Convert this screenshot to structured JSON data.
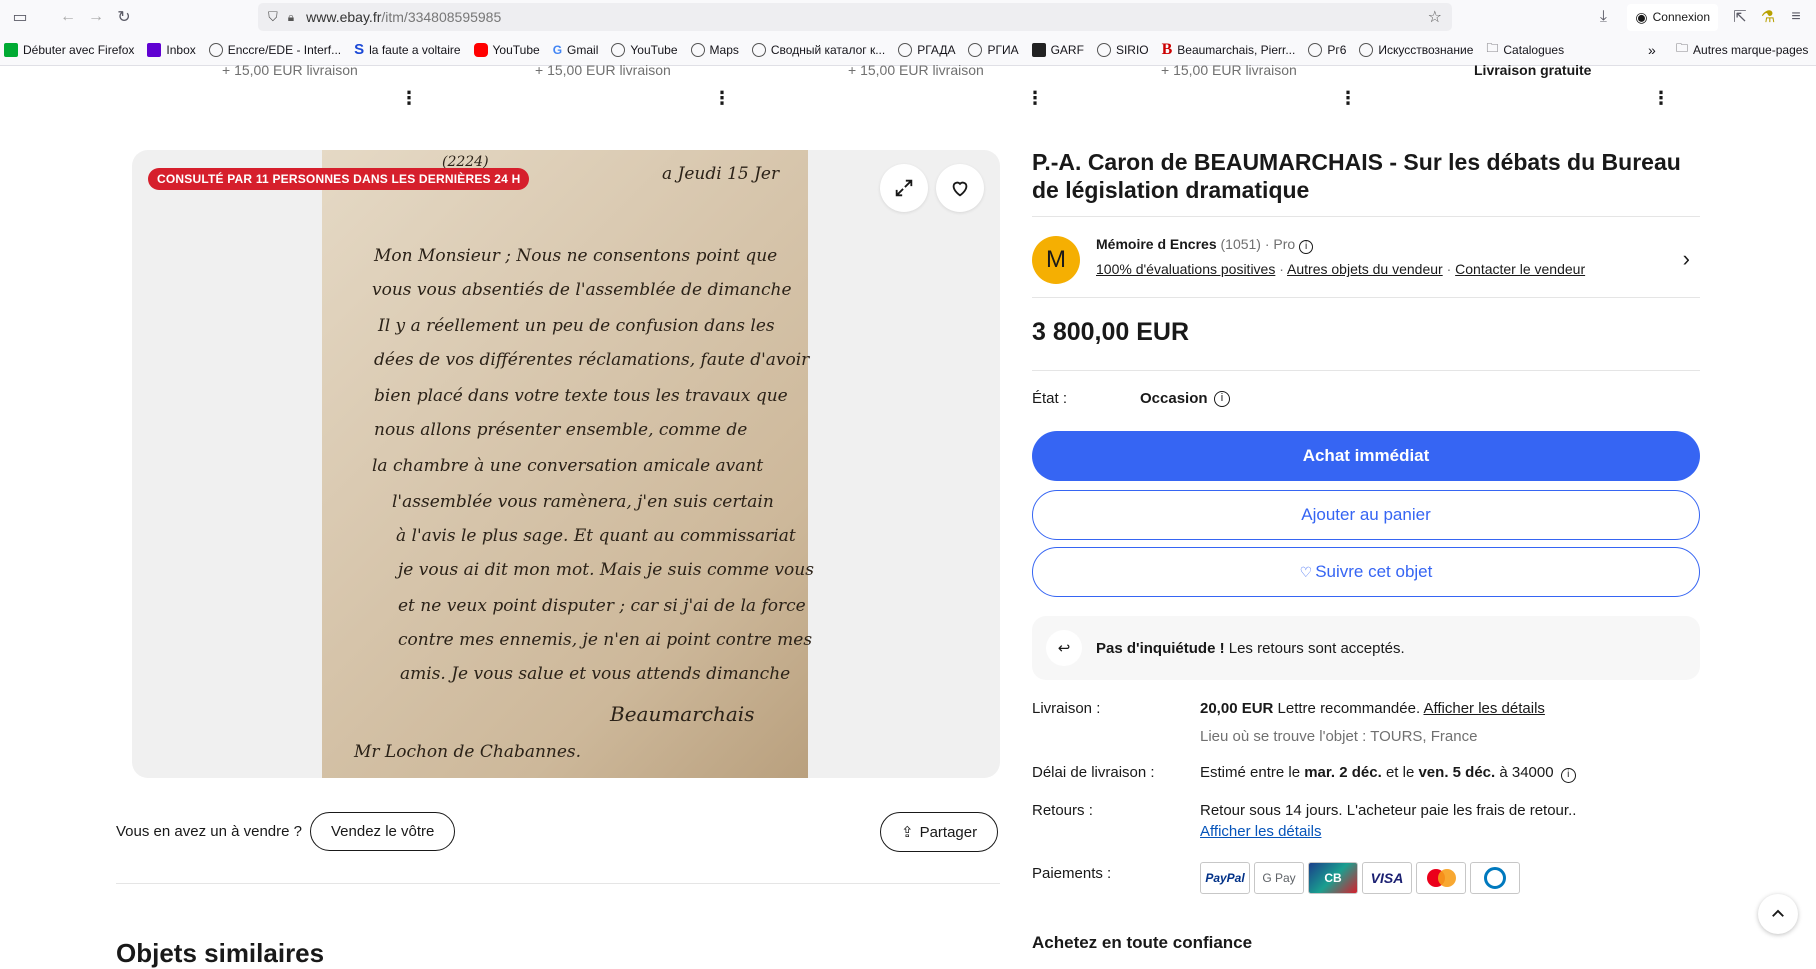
{
  "browser": {
    "url_domain": "www.ebay.fr",
    "url_path": "/itm/334808595985",
    "connexion_label": "Connexion"
  },
  "bookmarks": [
    {
      "label": "Débuter avec Firefox"
    },
    {
      "label": "Inbox"
    },
    {
      "label": "Enccre/EDE - Interf..."
    },
    {
      "label": "la faute a voltaire"
    },
    {
      "label": "YouTube"
    },
    {
      "label": "Gmail"
    },
    {
      "label": "YouTube"
    },
    {
      "label": "Maps"
    },
    {
      "label": "Сводный каталог к..."
    },
    {
      "label": "РГАДА"
    },
    {
      "label": "РГИА"
    },
    {
      "label": "GARF"
    },
    {
      "label": "SIRIO"
    },
    {
      "label": "Beaumarchais, Pierr..."
    },
    {
      "label": "Рг6"
    },
    {
      "label": "Искусствознание"
    },
    {
      "label": "Catalogues"
    }
  ],
  "bookmarks_other": "Autres marque-pages",
  "carousel": {
    "shipping": [
      "+ 15,00 EUR livraison",
      "+ 15,00 EUR livraison",
      "+ 15,00 EUR livraison",
      "+ 15,00 EUR livraison",
      "Livraison gratuite"
    ]
  },
  "gallery": {
    "badge": "CONSULTÉ PAR 11 PERSONNES DANS LES DERNIÈRES 24 H",
    "letter_lines": [
      "(2224)",
      "a Jeudi 15 Jer",
      "Mon Monsieur ; Nous ne consentons point que",
      "vous vous absentiés de l'assemblée de dimanche",
      "Il y a réellement un peu de confusion dans les",
      "dées de vos différentes réclamations, faute d'avoir",
      "bien placé dans votre texte tous les travaux que",
      "nous allons présenter ensemble, comme de",
      "la chambre à une conversation amicale avant",
      "l'assemblée vous ramènera, j'en suis certain",
      "à l'avis le plus sage. Et quant au commissariat",
      "je vous ai dit mon mot. Mais je suis comme vous",
      "et ne veux point disputer ; car si j'ai de la force",
      "contre mes ennemis, je n'en ai point contre mes",
      "amis. Je vous salue et vous attends dimanche",
      "Beaumarchais",
      "Mr Lochon de Chabannes."
    ]
  },
  "sell": {
    "question": "Vous en avez un à vendre ?",
    "sell_button": "Vendez le vôtre",
    "share_button": "Partager"
  },
  "similar_title": "Objets similaires",
  "item": {
    "title": "P.-A. Caron de BEAUMARCHAIS - Sur les débats du Bureau de législation dramatique",
    "price": "3 800,00 EUR",
    "etat_label": "État :",
    "etat_value": "Occasion"
  },
  "seller": {
    "initial": "M",
    "name": "Mémoire d Encres",
    "count": "(1051)",
    "pro": "· Pro",
    "positive": "100% d'évaluations positives",
    "other_items": "Autres objets du vendeur",
    "contact": "Contacter le vendeur",
    "sep": "·"
  },
  "actions": {
    "buy_now": "Achat immédiat",
    "add_cart": "Ajouter au panier",
    "watch": "Suivre cet objet"
  },
  "returns_box": {
    "bold": "Pas d'inquiétude !",
    "text": " Les retours sont acceptés."
  },
  "details": {
    "livraison_label": "Livraison :",
    "livraison_price": "20,00 EUR",
    "livraison_method": " Lettre recommandée. ",
    "livraison_link": "Afficher les détails",
    "location": "Lieu où se trouve l'objet : TOURS, France",
    "delai_label": "Délai de livraison :",
    "delai_prefix": "Estimé entre le ",
    "delai_start": "mar. 2 déc.",
    "delai_mid": " et le ",
    "delai_end": "ven. 5 déc.",
    "delai_suffix": " à 34000",
    "retours_label": "Retours :",
    "retours_text": "Retour sous 14 jours. L'acheteur paie les frais de retour..",
    "retours_link": "Afficher les détails",
    "paiements_label": "Paiements :",
    "payment_methods": [
      "PayPal",
      "G Pay",
      "CB",
      "VISA",
      "Mastercard",
      "Diners"
    ]
  },
  "confiance_title": "Achetez en toute confiance",
  "colors": {
    "primary": "#3665f3",
    "badge": "#d61f2c",
    "avatar": "#f5af02",
    "link": "#0654ba"
  }
}
